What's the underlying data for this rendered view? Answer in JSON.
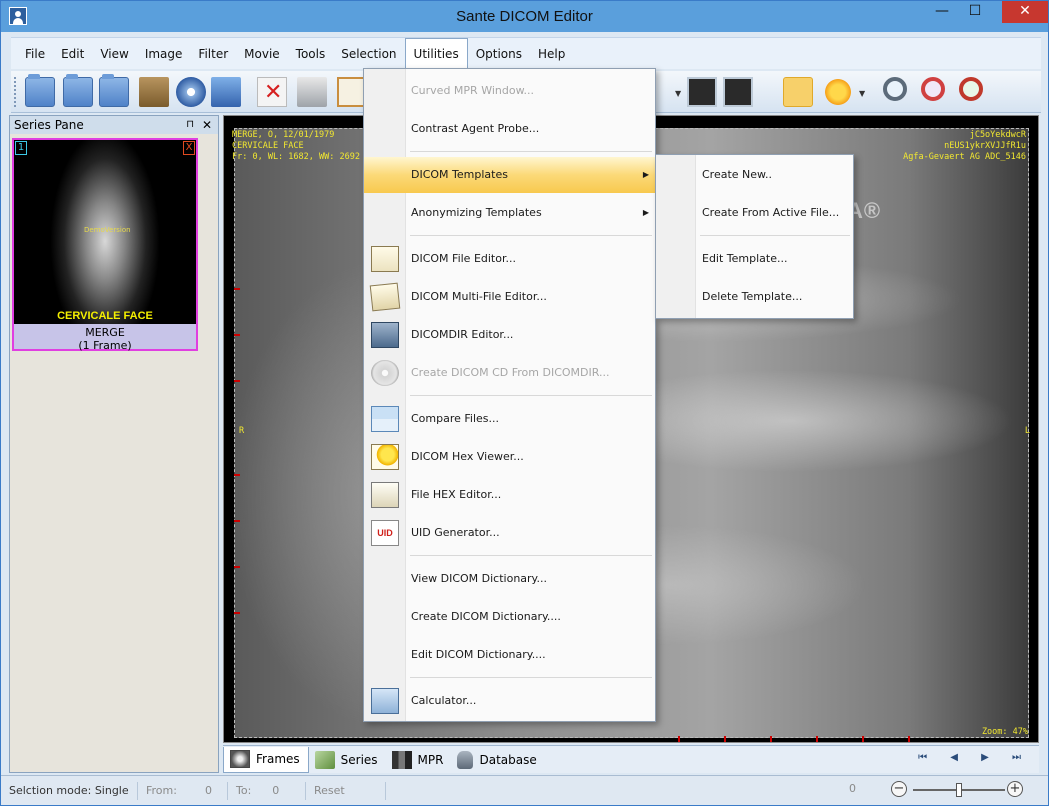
{
  "window": {
    "title": "Sante DICOM Editor"
  },
  "window_controls": {
    "minimize": "—",
    "maximize": "☐",
    "close": "✕"
  },
  "menubar": {
    "items": [
      "File",
      "Edit",
      "View",
      "Image",
      "Filter",
      "Movie",
      "Tools",
      "Selection",
      "Utilities",
      "Options",
      "Help"
    ],
    "active": "Utilities"
  },
  "toolbar": {
    "icons": [
      "open-folder-icon",
      "open-folder-icon",
      "open-folder-icon",
      "book-icon",
      "disc-icon",
      "network-icon",
      "delete-icon",
      "print-icon",
      "clipboard-icon",
      "image-icon",
      "image-icon",
      "hand-icon",
      "brightness-icon",
      "zoom-icon",
      "zoom-window-icon",
      "zoom-fit-icon"
    ]
  },
  "series_pane": {
    "title": "Series Pane",
    "pin": "⊓",
    "close": "✕",
    "thumbnail": {
      "index": "1",
      "remove": "X",
      "demo_text": "DemoVersion",
      "caption": "CERVICALE FACE",
      "label_line1": "MERGE",
      "label_line2": "(1 Frame)"
    }
  },
  "viewer": {
    "overlay_top_left": [
      "MERGE, O, 12/01/1979",
      "CERVICALE FACE",
      "Fr: 0, WL: 1682, WW: 2692"
    ],
    "overlay_top_right": [
      "jC5oYekdwcR",
      "nEUS1ykrXVJJfR1u",
      "Agfa-Gevaert AG ADC_5146"
    ],
    "orientation_left": "R",
    "orientation_right": "L",
    "zoom": "Zoom: 47%",
    "watermark": "SOFTPEDIA®"
  },
  "bottom_tabs": {
    "tabs": [
      "Frames",
      "Series",
      "MPR",
      "Database"
    ],
    "active": "Frames",
    "nav": "⏮ ◀ ▶ ⏭"
  },
  "statusbar": {
    "mode": "Selction mode: Single",
    "from_label": "From:",
    "from_value": "0",
    "to_label": "To:",
    "to_value": "0",
    "reset": "Reset",
    "zoom_value": "0",
    "zoom_minus": "−",
    "zoom_plus": "+"
  },
  "utilities_menu": {
    "items": [
      {
        "label": "Curved MPR Window...",
        "disabled": true
      },
      {
        "label": "Contrast Agent Probe..."
      },
      {
        "label": "DICOM Templates",
        "submenu": true
      },
      {
        "label": "Anonymizing Templates",
        "submenu": true
      },
      {
        "label": "DICOM File Editor...",
        "icon": "page-edit-icon"
      },
      {
        "label": "DICOM Multi-File Editor...",
        "icon": "multi-page-edit-icon"
      },
      {
        "label": "DICOMDIR Editor...",
        "icon": "dicomdir-icon"
      },
      {
        "label": "Create DICOM CD From DICOMDIR...",
        "icon": "cd-icon",
        "disabled": true
      },
      {
        "label": "Compare Files...",
        "icon": "compare-icon"
      },
      {
        "label": "DICOM Hex Viewer...",
        "icon": "bulb-icon"
      },
      {
        "label": "File HEX Editor...",
        "icon": "hex-edit-icon"
      },
      {
        "label": "UID Generator...",
        "icon": "uid-icon"
      },
      {
        "label": "View DICOM Dictionary..."
      },
      {
        "label": "Create DICOM Dictionary...."
      },
      {
        "label": "Edit DICOM Dictionary...."
      },
      {
        "label": "Calculator...",
        "icon": "calculator-icon"
      }
    ],
    "arrow": "▶",
    "uid_icon_text": "UID"
  },
  "templates_submenu": {
    "items": [
      "Create New..",
      "Create From Active File...",
      "Edit Template...",
      "Delete Template..."
    ]
  }
}
